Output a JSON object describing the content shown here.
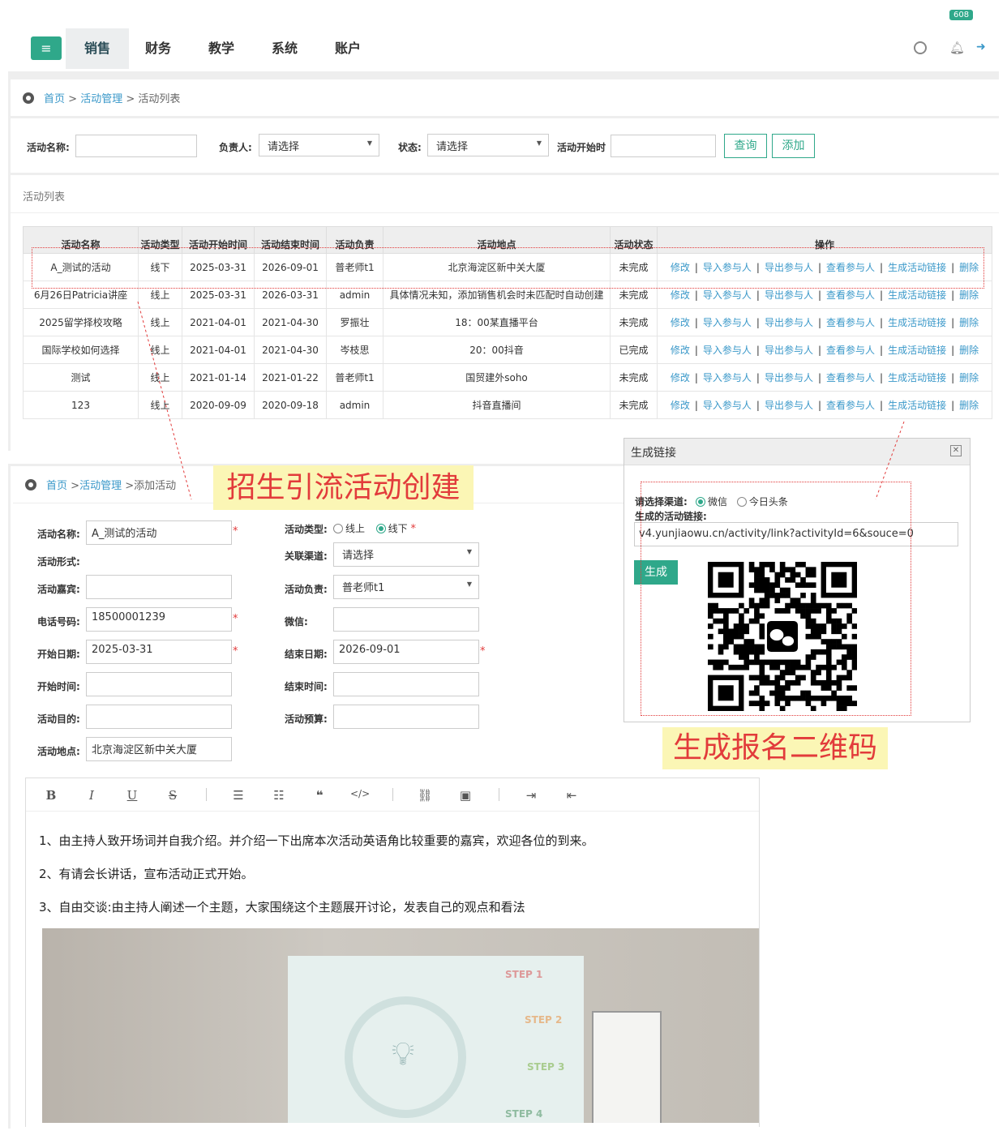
{
  "nav": {
    "tabs": [
      "销售",
      "财务",
      "教学",
      "系统",
      "账户"
    ],
    "badge_count": "608"
  },
  "list_page": {
    "breadcrumb": {
      "home": "首页",
      "section": "活动管理",
      "current": "活动列表",
      "sep": ">"
    },
    "filters": {
      "name_label": "活动名称:",
      "owner_label": "负责人:",
      "owner_value": "请选择",
      "status_label": "状态:",
      "status_value": "请选择",
      "start_label": "活动开始时",
      "query_button": "查询",
      "add_button": "添加"
    },
    "list_title": "活动列表",
    "columns": [
      "活动名称",
      "活动类型",
      "活动开始时间",
      "活动结束时间",
      "活动负责",
      "活动地点",
      "活动状态",
      "操作"
    ],
    "rows": [
      [
        "A_测试的活动",
        "线下",
        "2025-03-31",
        "2026-09-01",
        "普老师t1",
        "北京海淀区新中关大厦",
        "未完成"
      ],
      [
        "6月26日Patricia讲座",
        "线上",
        "2025-03-31",
        "2026-03-31",
        "admin",
        "具体情况未知，添加销售机会时未匹配时自动创建",
        "未完成"
      ],
      [
        "2025留学择校攻略",
        "线上",
        "2021-04-01",
        "2021-04-30",
        "罗振壮",
        "18：00某直播平台",
        "未完成"
      ],
      [
        "国际学校如何选择",
        "线上",
        "2021-04-01",
        "2021-04-30",
        "岑枝思",
        "20：00抖音",
        "已完成"
      ],
      [
        "测试",
        "线上",
        "2021-01-14",
        "2021-01-22",
        "普老师t1",
        "国贸建外soho",
        "未完成"
      ],
      [
        "123",
        "线上",
        "2020-09-09",
        "2020-09-18",
        "admin",
        "抖音直播间",
        "未完成"
      ]
    ],
    "actions": [
      "修改",
      "导入参与人",
      "导出参与人",
      "查看参与人",
      "生成活动链接",
      "删除"
    ],
    "action_sep": "|"
  },
  "form_page": {
    "breadcrumb": {
      "home": "首页",
      "section": "活动管理",
      "current": "添加活动",
      "sep": ">"
    },
    "left_labels": [
      "活动名称:",
      "活动形式:",
      "活动嘉宾:",
      "电话号码:",
      "开始日期:",
      "开始时间:",
      "活动目的:",
      "活动地点:"
    ],
    "name_value": "A_测试的活动",
    "phone_value": "18500001239",
    "start_date_value": "2025-03-31",
    "location_value": "北京海淀区新中关大厦",
    "right_labels": [
      "活动类型:",
      "关联渠道:",
      "活动负责:",
      "微信:",
      "结束日期:",
      "结束时间:",
      "活动预算:"
    ],
    "type_online": "线上",
    "type_offline": "线下",
    "channel_value": "请选择",
    "owner_value": "普老师t1",
    "end_date_value": "2026-09-01",
    "required_mark": "*"
  },
  "editor": {
    "toolbar": [
      "bold-icon",
      "italic-icon",
      "underline-icon",
      "strikethrough-icon",
      "ordered-list-icon",
      "bullet-list-icon",
      "quote-icon",
      "code-icon",
      "link-icon",
      "image-icon",
      "indent-icon",
      "outdent-icon"
    ],
    "lines": [
      "1、由主持人致开场词并自我介绍。并介绍一下出席本次活动英语角比较重要的嘉宾，欢迎各位的到来。",
      "2、有请会长讲话，宣布活动正式开始。",
      "3、自由交谈:由主持人阐述一个主题，大家围绕这个主题展开讨论，发表自己的观点和看法"
    ],
    "slide_steps": [
      "STEP 1",
      "STEP 2",
      "STEP 3",
      "STEP 4"
    ]
  },
  "dialog": {
    "title": "生成链接",
    "channel_label": "请选择渠道:",
    "channel_wechat": "微信",
    "channel_toutiao": "今日头条",
    "link_label": "生成的活动链接:",
    "link_value": "v4.yunjiaowu.cn/activity/link?activityId=6&souce=0",
    "generate_button": "生成"
  },
  "annotations": {
    "create_caption": "招生引流活动创建",
    "qr_caption": "生成报名二维码"
  },
  "colors": {
    "accent": "#2fa88a",
    "link": "#3a98c9",
    "annotation": "#e23b3b",
    "caption_bg": "#fbf6b5"
  }
}
